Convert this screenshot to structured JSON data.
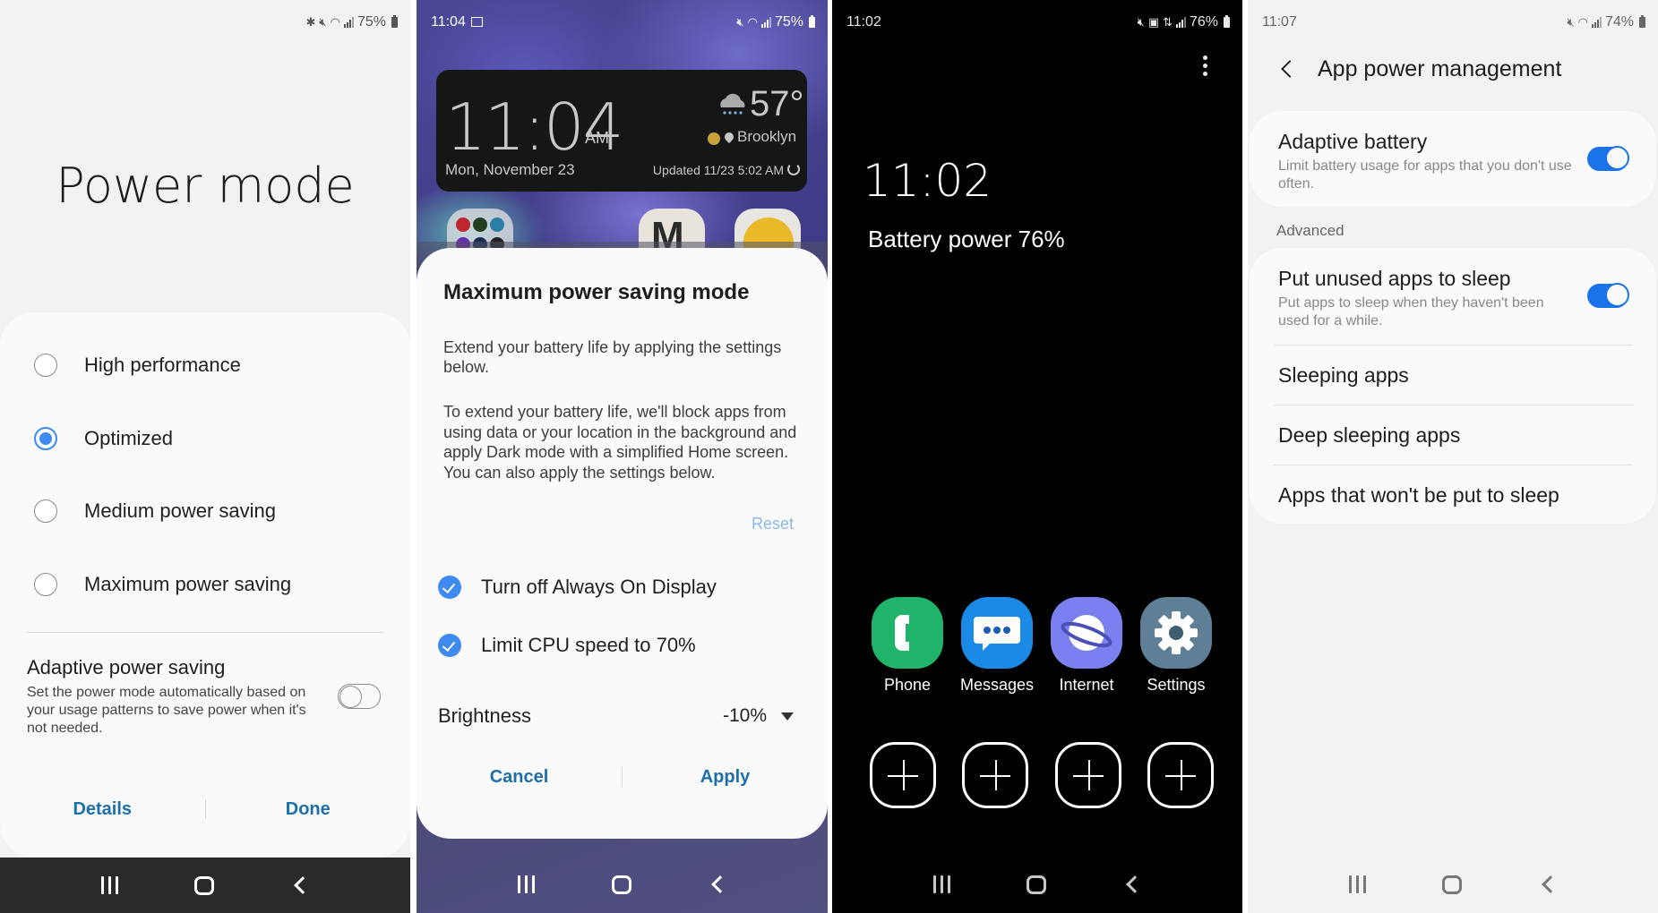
{
  "panels": {
    "power_mode": {
      "status": {
        "battery": "75%"
      },
      "title": "Power mode",
      "options": [
        {
          "label": "High performance",
          "selected": false
        },
        {
          "label": "Optimized",
          "selected": true
        },
        {
          "label": "Medium power saving",
          "selected": false
        },
        {
          "label": "Maximum power saving",
          "selected": false
        }
      ],
      "adaptive": {
        "title": "Adaptive power saving",
        "description": "Set the power mode automatically based on your usage patterns to save power when it's not needed.",
        "enabled": false
      },
      "buttons": {
        "details": "Details",
        "done": "Done"
      }
    },
    "max_saving_dialog": {
      "status": {
        "time": "11:04",
        "battery": "75%"
      },
      "widget": {
        "time": "11:04",
        "ampm": "AM",
        "date": "Mon, November 23",
        "temperature": "57°",
        "location": "Brooklyn",
        "updated": "Updated 11/23 5:02 AM"
      },
      "title": "Maximum power saving mode",
      "paragraph1": "Extend your battery life by applying the settings below.",
      "paragraph2": "To extend your battery life, we'll block apps from using data or your location in the background and apply Dark mode with a simplified Home screen. You can also apply the settings below.",
      "reset": "Reset",
      "checks": [
        {
          "label": "Turn off Always On Display",
          "checked": true
        },
        {
          "label": "Limit CPU speed to 70%",
          "checked": true
        }
      ],
      "brightness": {
        "label": "Brightness",
        "value": "-10%"
      },
      "buttons": {
        "cancel": "Cancel",
        "apply": "Apply"
      }
    },
    "max_saving_home": {
      "status": {
        "time": "11:02",
        "battery": "76%"
      },
      "time": "11:02",
      "battery_text": "Battery power 76%",
      "apps": [
        {
          "label": "Phone",
          "icon": "phone-icon",
          "color": "#20b46b"
        },
        {
          "label": "Messages",
          "icon": "messages-icon",
          "color": "#1a8ae6"
        },
        {
          "label": "Internet",
          "icon": "internet-icon",
          "color": "#7a80f0"
        },
        {
          "label": "Settings",
          "icon": "settings-icon",
          "color": "#5e7f96"
        }
      ],
      "add_slots": 4
    },
    "app_power_mgmt": {
      "status": {
        "time": "11:07",
        "battery": "74%"
      },
      "title": "App power management",
      "adaptive_battery": {
        "title": "Adaptive battery",
        "description": "Limit battery usage for apps that you don't use often.",
        "enabled": true
      },
      "section_label": "Advanced",
      "put_unused": {
        "title": "Put unused apps to sleep",
        "description": "Put apps to sleep when they haven't been used for a while.",
        "enabled": true
      },
      "items": [
        "Sleeping apps",
        "Deep sleeping apps",
        "Apps that won't be put to sleep"
      ]
    }
  },
  "colors": {
    "accent": "#3e8af0",
    "toggle_on": "#1a73e8",
    "button_text": "#1d6fa8"
  }
}
